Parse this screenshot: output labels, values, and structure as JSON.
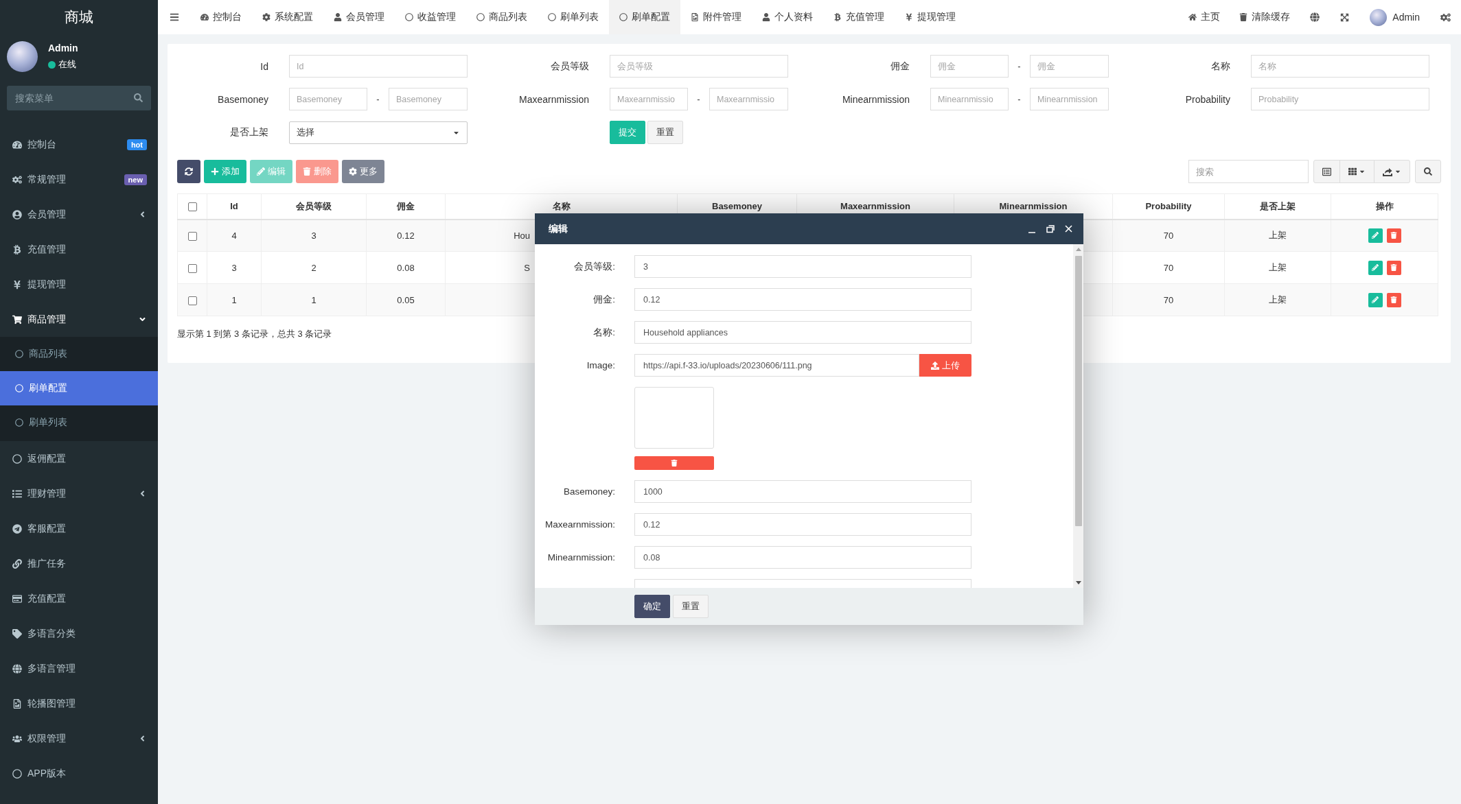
{
  "sidebar": {
    "logo": "商城",
    "user": {
      "name": "Admin",
      "status": "在线",
      "online": true
    },
    "search": {
      "placeholder": "搜索菜单"
    },
    "items": [
      {
        "label": "控制台",
        "selected": false,
        "badge": {
          "text": "hot",
          "color": "#2d8cf0"
        }
      },
      {
        "label": "常规管理",
        "selected": false,
        "badge": {
          "text": "new",
          "color": "#6a5fb0"
        }
      },
      {
        "label": "会员管理",
        "selected": false,
        "expanded": false
      },
      {
        "label": "充值管理",
        "selected": false
      },
      {
        "label": "提现管理",
        "selected": false
      },
      {
        "label": "商品管理",
        "selected": false,
        "expanded": true,
        "children": [
          {
            "label": "商品列表",
            "selected": false
          },
          {
            "label": "刷单配置",
            "selected": true
          },
          {
            "label": "刷单列表",
            "selected": false
          }
        ]
      },
      {
        "label": "返佣配置",
        "selected": false
      },
      {
        "label": "理财管理",
        "selected": false,
        "expanded": false
      },
      {
        "label": "客服配置",
        "selected": false
      },
      {
        "label": "推广任务",
        "selected": false
      },
      {
        "label": "充值配置",
        "selected": false
      },
      {
        "label": "多语言分类",
        "selected": false
      },
      {
        "label": "多语言管理",
        "selected": false
      },
      {
        "label": "轮播图管理",
        "selected": false
      },
      {
        "label": "权限管理",
        "selected": false,
        "expanded": false
      },
      {
        "label": "APP版本",
        "selected": false
      }
    ]
  },
  "top_nav": {
    "tabs": [
      {
        "label": "控制台",
        "selected": false
      },
      {
        "label": "系统配置",
        "selected": false
      },
      {
        "label": "会员管理",
        "selected": false
      },
      {
        "label": "收益管理",
        "selected": false
      },
      {
        "label": "商品列表",
        "selected": false
      },
      {
        "label": "刷单列表",
        "selected": false
      },
      {
        "label": "刷单配置",
        "selected": true
      },
      {
        "label": "附件管理",
        "selected": false
      },
      {
        "label": "个人资料",
        "selected": false
      },
      {
        "label": "充值管理",
        "selected": false
      },
      {
        "label": "提现管理",
        "selected": false
      }
    ],
    "links": [
      "主页",
      "清除缓存"
    ],
    "user": {
      "name": "Admin"
    }
  },
  "filter": {
    "fields": [
      {
        "kind": "text",
        "label": "Id",
        "placeholder": "Id"
      },
      {
        "kind": "text",
        "label": "会员等级",
        "placeholder": "会员等级"
      },
      {
        "kind": "range",
        "label": "佣金",
        "placeholders": [
          "佣金",
          "佣金"
        ],
        "separator": "-"
      },
      {
        "kind": "text",
        "label": "名称",
        "placeholder": "名称"
      },
      {
        "kind": "range",
        "label": "Basemoney",
        "placeholders": [
          "Basemoney",
          "Basemoney"
        ],
        "separator": "-"
      },
      {
        "kind": "range",
        "label": "Maxearnmission",
        "placeholders": [
          "Maxearnmissio",
          "Maxearnmissio"
        ],
        "separator": "-"
      },
      {
        "kind": "range",
        "label": "Minearnmission",
        "placeholders": [
          "Minearnmissio",
          "Minearnmission"
        ],
        "separator": "-"
      },
      {
        "kind": "text",
        "label": "Probability",
        "placeholder": "Probability"
      },
      {
        "kind": "select",
        "label": "是否上架",
        "value": "选择"
      }
    ],
    "buttons": [
      {
        "kind": "submit",
        "label": "提交"
      },
      {
        "kind": "reset",
        "label": "重置"
      }
    ]
  },
  "toolbar": {
    "buttons": [
      {
        "kind": "refresh",
        "disabled": false
      },
      {
        "kind": "add",
        "label": "添加",
        "disabled": false
      },
      {
        "kind": "edit",
        "label": "编辑",
        "disabled": true
      },
      {
        "kind": "delete",
        "label": "删除",
        "disabled": true
      },
      {
        "kind": "more",
        "label": "更多",
        "disabled": false
      }
    ],
    "search": {
      "placeholder": "搜索"
    }
  },
  "table": {
    "select_all": {
      "checked": false
    },
    "columns": [
      "Id",
      "会员等级",
      "佣金",
      "名称",
      "Basemoney",
      "Maxearnmission",
      "Minearnmission",
      "Probability",
      "是否上架",
      "操作"
    ],
    "rows": [
      {
        "checked": false,
        "id": "4",
        "level": "3",
        "commission": "0.12",
        "name": "Hou",
        "probability": "70",
        "status": "上架"
      },
      {
        "checked": false,
        "id": "3",
        "level": "2",
        "commission": "0.08",
        "name": "S",
        "probability": "70",
        "status": "上架"
      },
      {
        "checked": false,
        "id": "1",
        "level": "1",
        "commission": "0.05",
        "probability": "70",
        "status": "上架"
      }
    ],
    "summary": "显示第 1 到第 3 条记录，总共 3 条记录"
  },
  "modal": {
    "title": "编辑",
    "rows": [
      {
        "kind": "text",
        "label": "会员等级:",
        "value": "3"
      },
      {
        "kind": "text",
        "label": "佣金:",
        "value": "0.12"
      },
      {
        "kind": "text",
        "label": "名称:",
        "value": "Household appliances"
      },
      {
        "kind": "image",
        "label": "Image:",
        "value": "https://api.f-33.io/uploads/20230606/111.png",
        "button": "上传"
      },
      {
        "kind": "text",
        "label": "Basemoney:",
        "value": "1000"
      },
      {
        "kind": "text",
        "label": "Maxearnmission:",
        "value": "0.12"
      },
      {
        "kind": "text",
        "label": "Minearnmission:",
        "value": "0.08"
      },
      {
        "kind": "cut"
      }
    ],
    "buttons": [
      {
        "kind": "primary",
        "label": "确定"
      },
      {
        "kind": "default",
        "label": "重置"
      }
    ]
  }
}
